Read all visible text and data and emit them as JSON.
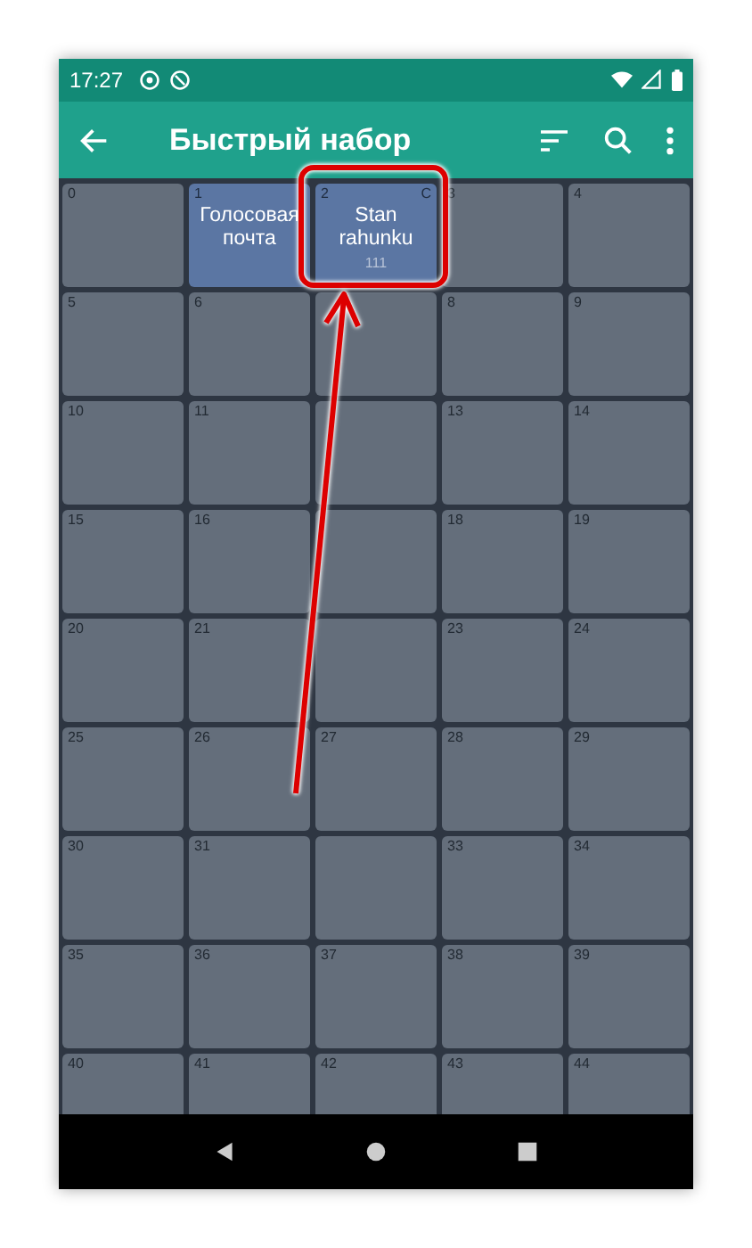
{
  "status_bar": {
    "time": "17:27"
  },
  "toolbar": {
    "title": "Быстрый набор"
  },
  "cells": [
    {
      "kind": "empty",
      "number": "0"
    },
    {
      "kind": "assigned",
      "number": "1",
      "name": "Голосовая почта"
    },
    {
      "kind": "assigned",
      "number": "2",
      "tag": "C",
      "name": "Stan rahunku",
      "phone": "111"
    },
    {
      "kind": "empty",
      "number": "3"
    },
    {
      "kind": "empty",
      "number": "4"
    },
    {
      "kind": "empty",
      "number": "5"
    },
    {
      "kind": "empty",
      "number": "6"
    },
    {
      "kind": "empty"
    },
    {
      "kind": "empty",
      "number": "8"
    },
    {
      "kind": "empty",
      "number": "9"
    },
    {
      "kind": "empty",
      "number": "10"
    },
    {
      "kind": "empty",
      "number": "11"
    },
    {
      "kind": "empty"
    },
    {
      "kind": "empty",
      "number": "13"
    },
    {
      "kind": "empty",
      "number": "14"
    },
    {
      "kind": "empty",
      "number": "15"
    },
    {
      "kind": "empty",
      "number": "16"
    },
    {
      "kind": "empty"
    },
    {
      "kind": "empty",
      "number": "18"
    },
    {
      "kind": "empty",
      "number": "19"
    },
    {
      "kind": "empty",
      "number": "20"
    },
    {
      "kind": "empty",
      "number": "21"
    },
    {
      "kind": "empty"
    },
    {
      "kind": "empty",
      "number": "23"
    },
    {
      "kind": "empty",
      "number": "24"
    },
    {
      "kind": "empty",
      "number": "25"
    },
    {
      "kind": "empty",
      "number": "26"
    },
    {
      "kind": "empty",
      "number": "27"
    },
    {
      "kind": "empty",
      "number": "28"
    },
    {
      "kind": "empty",
      "number": "29"
    },
    {
      "kind": "empty",
      "number": "30"
    },
    {
      "kind": "empty",
      "number": "31"
    },
    {
      "kind": "empty"
    },
    {
      "kind": "empty",
      "number": "33"
    },
    {
      "kind": "empty",
      "number": "34"
    },
    {
      "kind": "empty",
      "number": "35"
    },
    {
      "kind": "empty",
      "number": "36"
    },
    {
      "kind": "empty",
      "number": "37"
    },
    {
      "kind": "empty",
      "number": "38"
    },
    {
      "kind": "empty",
      "number": "39"
    },
    {
      "kind": "empty",
      "number": "40"
    },
    {
      "kind": "empty",
      "number": "41"
    },
    {
      "kind": "empty",
      "number": "42"
    },
    {
      "kind": "empty",
      "number": "43"
    },
    {
      "kind": "empty",
      "number": "44"
    }
  ]
}
